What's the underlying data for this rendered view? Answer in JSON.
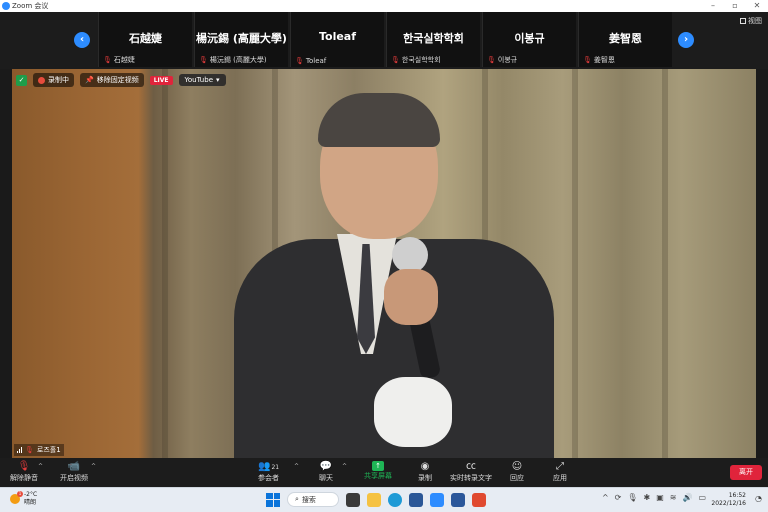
{
  "window": {
    "title": "Zoom 会议"
  },
  "topbar": {
    "view_label": "视图",
    "tiles": [
      {
        "name": "石越婕",
        "label": "石越婕"
      },
      {
        "name": "楊沅錫 (高麗大學)",
        "label": "楊沅錫 (高麗大學)"
      },
      {
        "name": "Toleaf",
        "label": "Toleaf"
      },
      {
        "name": "한국실학학회",
        "label": "한국실학학회"
      },
      {
        "name": "이봉규",
        "label": "이봉규"
      },
      {
        "name": "姜智恩",
        "label": "姜智恩"
      }
    ]
  },
  "video": {
    "recording_label": "录制中",
    "unpin_label": "移除固定视频",
    "live_label": "LIVE",
    "stream_label": "YouTube",
    "speaker_label": "로즈홀1"
  },
  "toolbar": {
    "unmute_label": "解除静音",
    "start_video_label": "开启视频",
    "participants_label": "参会者",
    "participants_count": "21",
    "chat_label": "聊天",
    "share_label": "共享屏幕",
    "record_label": "录制",
    "captions_label": "实时转录文字",
    "reactions_label": "回应",
    "apps_label": "应用",
    "leave_label": "离开"
  },
  "taskbar": {
    "temperature": "-2°C",
    "weather_text": "晴朗",
    "weather_badge": "1",
    "search_label": "搜索",
    "time": "16:52",
    "date": "2022/12/16"
  },
  "colors": {
    "accent_blue": "#2d8cff",
    "live_red": "#e0243b",
    "share_green": "#1fb556",
    "mute_red": "#e23b3b"
  }
}
